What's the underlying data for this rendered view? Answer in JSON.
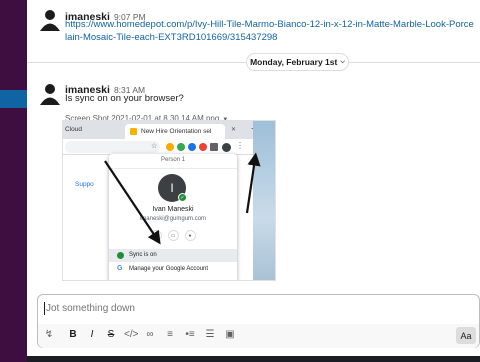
{
  "messages": [
    {
      "author": "imaneski",
      "time": "9:07 PM",
      "link": "https://www.homedepot.com/p/Ivy-Hill-Tile-Marmo-Bianco-12-in-x-12-in-Matte-Marble-Look-Porcelain-Mosaic-Tile-each-EXT3RD101669/315437298"
    },
    {
      "author": "imaneski",
      "time": "8:31 AM",
      "text": "Is sync on on your browser?",
      "attachment": {
        "filename": "Screen Shot 2021-02-01 at 8.30.14 AM.png",
        "browser": {
          "tab_left": "Cloud",
          "tab_active": "New Hire Orientation sel",
          "support_link": "Suppo",
          "profile": {
            "person_label": "Person 1",
            "initial": "I",
            "name": "Ivan Maneski",
            "email": "imaneski@gumgum.com",
            "sync_label": "Sync is on",
            "manage_label": "Manage your Google Account"
          }
        }
      }
    }
  ],
  "date_divider": {
    "label": "Monday, February 1st"
  },
  "composer": {
    "placeholder": "Jot something down",
    "format_icons": [
      "lightning-icon",
      "bold-icon",
      "italic-icon",
      "strikethrough-icon",
      "code-icon",
      "link-icon",
      "ordered-list-icon",
      "bulleted-list-icon",
      "blockquote-icon",
      "code-block-icon"
    ],
    "aa_label": "Aa"
  },
  "colors": {
    "sidebar": "#3f0e40",
    "active": "#1164a3",
    "link": "#1264a3",
    "sync_green": "#1e8e3e"
  }
}
